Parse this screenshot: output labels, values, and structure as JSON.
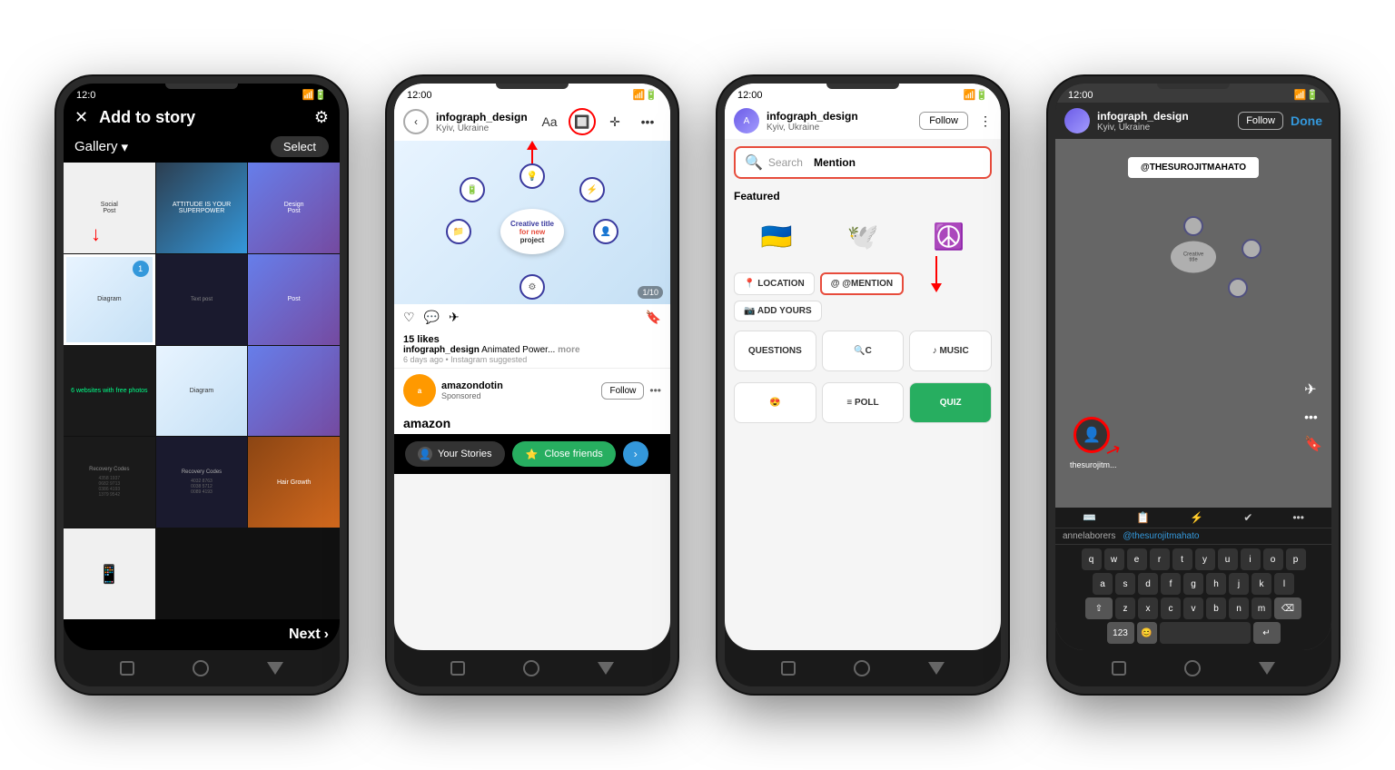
{
  "scene": {
    "bg": "#ffffff"
  },
  "phone1": {
    "status_time": "12:0",
    "header_title": "Add to story",
    "gallery_label": "Gallery",
    "select_label": "Select",
    "next_label": "Next",
    "cells": [
      {
        "type": "social",
        "selected": false
      },
      {
        "type": "attitude",
        "label": "ATTITUDE IS YOUR SUPERPOWER",
        "selected": false
      },
      {
        "type": "colorful",
        "selected": false
      },
      {
        "type": "blue-diagram",
        "selected": true,
        "badge": "1"
      },
      {
        "type": "dark-text",
        "selected": false
      },
      {
        "type": "colorful2",
        "selected": false
      },
      {
        "type": "websites",
        "label": "6 websites with free photos",
        "selected": false
      },
      {
        "type": "blue2",
        "selected": false
      },
      {
        "type": "recovery3",
        "selected": false
      },
      {
        "type": "recovery",
        "label": "Recovery Codes",
        "selected": false
      },
      {
        "type": "recovery2",
        "label": "Recovery Codes",
        "selected": false
      },
      {
        "type": "flowers",
        "selected": false
      },
      {
        "type": "phone-icon",
        "selected": false
      },
      {
        "type": "blank",
        "selected": false
      },
      {
        "type": "blank2",
        "selected": false
      }
    ]
  },
  "phone2": {
    "username": "infograph_design",
    "location": "Kyiv, Ukraine",
    "tools": [
      "Aa",
      "sticker",
      "move",
      "more"
    ],
    "diagram": {
      "center_title": "Creative title",
      "center_sub": "for new project"
    },
    "bottom_bar": {
      "your_stories": "Your Stories",
      "close_friends": "Close friends",
      "send_icon": "›"
    },
    "red_arrow_label": "sticker tool highlighted"
  },
  "phone3": {
    "username": "infograph_design",
    "location": "Kyiv, Ukraine",
    "follow_label": "Follow",
    "search_placeholder": "Search",
    "mention_label": "Mention",
    "featured_label": "Featured",
    "stickers": [
      "🇺🇦",
      "🕊️",
      "☮️"
    ],
    "tags": [
      {
        "label": "LOCATION",
        "icon": "📍",
        "type": "location"
      },
      {
        "label": "@MENTION",
        "icon": "@",
        "type": "mention"
      },
      {
        "label": "ADD YOURS",
        "icon": "➕",
        "type": "addyours"
      }
    ],
    "sticker_rows": [
      {
        "label": "QUESTIONS"
      },
      {
        "label": "Q"
      },
      {
        "label": "♪ MUSIC"
      }
    ],
    "sticker_rows2": [
      {
        "label": "😍 POLL"
      },
      {
        "label": "≡ POLL"
      },
      {
        "label": "QUIZ"
      }
    ]
  },
  "phone4": {
    "username": "infograph_design",
    "location": "Kyiv, Ukraine",
    "follow_label": "Follow",
    "done_label": "Done",
    "mention_tag": "@THESUROJITMAHATO",
    "username_small": "thesurojitm...",
    "keyboard": {
      "suggest1": "annelaborers",
      "suggest2": "@thesurojitmahato",
      "rows": [
        [
          "q",
          "w",
          "e",
          "r",
          "t",
          "y",
          "u",
          "i",
          "o",
          "p"
        ],
        [
          "a",
          "s",
          "d",
          "f",
          "g",
          "h",
          "j",
          "k",
          "l"
        ],
        [
          "⇧",
          "z",
          "x",
          "c",
          "v",
          "b",
          "n",
          "m",
          "⌫"
        ],
        [
          "123",
          "😊",
          "space",
          "return"
        ]
      ]
    },
    "toolbar_icons": [
      "⌨️",
      "📋",
      "⚡",
      "✔️",
      "•••"
    ]
  }
}
